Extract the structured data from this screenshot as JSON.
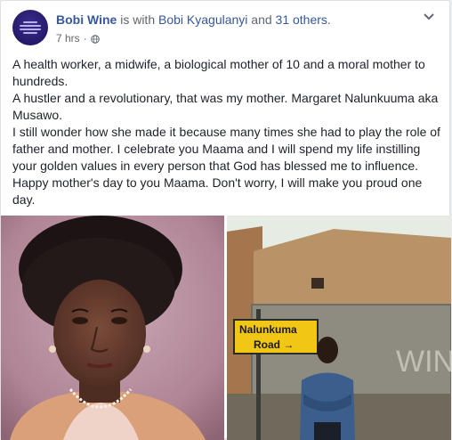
{
  "post": {
    "author": "Bobi Wine",
    "with_text": " is with ",
    "tagged_person": "Bobi Kyagulanyi",
    "and_text": " and ",
    "others": "31 others",
    "period": ".",
    "time": "7 hrs",
    "separator": " · ",
    "audience_icon": "globe-icon",
    "more_icon": "chevron-down-icon",
    "paragraphs": [
      "A health worker, a midwife, a biological mother of 10 and a moral mother to hundreds.",
      "A hustler and a revolutionary, that was my mother. Margaret Nalunkuuma aka Musawo.",
      "I still wonder how she made it because many times she had to play the role of father and mother. I celebrate you Maama and I will spend my life instilling your golden values in every person that God has blessed me to influence. Happy mother's day to you Maama. Don't worry, I will make you proud one day."
    ]
  },
  "photos": [
    {
      "alt": "Portrait of Margaret Nalunkuuma"
    },
    {
      "sign_line1": "Nalunkuma",
      "sign_line2": "Road →",
      "wall_graffiti": "WINE"
    }
  ],
  "colors": {
    "link": "#365899",
    "text": "#1d2129",
    "muted": "#616770",
    "sign_yellow": "#f2c615"
  }
}
